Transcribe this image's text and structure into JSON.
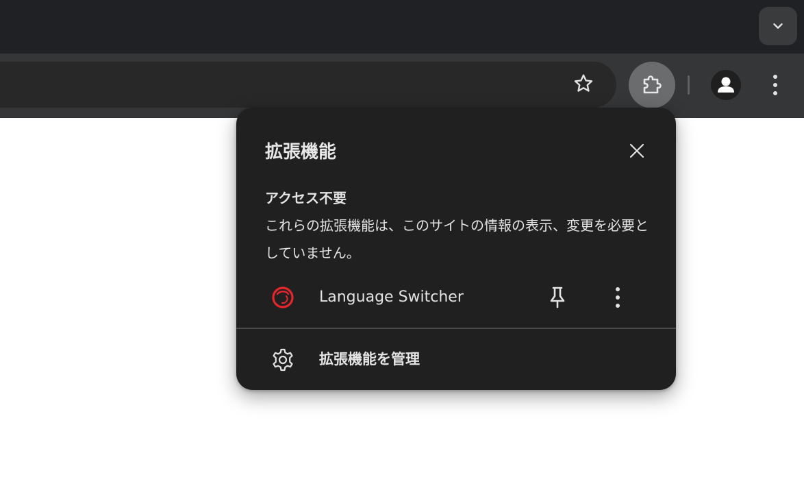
{
  "browser": {
    "toolbar": {
      "bookmark_icon": "star-icon",
      "extensions_icon": "puzzle-icon",
      "profile_icon": "person-icon",
      "menu_icon": "more-vert-icon"
    },
    "tabstrip": {
      "tab_search_icon": "chevron-down-icon"
    }
  },
  "extensions_popup": {
    "title": "拡張機能",
    "close_icon": "close-icon",
    "section_heading": "アクセス不要",
    "section_description": "これらの拡張機能は、このサイトの情報の表示、変更を必要としていません。",
    "extensions": [
      {
        "name": "Language Switcher",
        "icon": "language-switcher-icon",
        "icon_color": "#e5262b",
        "pin_icon": "pin-icon",
        "more_icon": "more-vert-icon"
      }
    ],
    "manage_label": "拡張機能を管理",
    "manage_icon": "gear-icon"
  },
  "colors": {
    "tabstrip_bg": "#202124",
    "toolbar_bg": "#353638",
    "omnibox_bg": "#282828",
    "popup_bg": "#202020",
    "active_button_bg": "#6b6c6e",
    "text": "#e3e3e3",
    "page_bg": "#ffffff"
  }
}
